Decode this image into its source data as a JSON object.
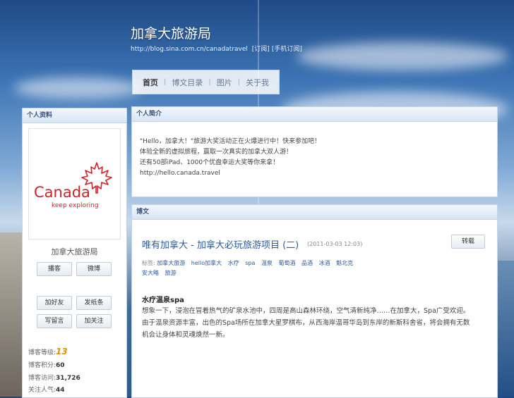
{
  "header": {
    "title": "加拿大旅游局",
    "url": "http://blog.sina.com.cn/canadatravel",
    "subscribe_link": "[订阅]",
    "mobile_subscribe_link": "[手机订阅]"
  },
  "nav": {
    "items": [
      "首页",
      "博文目录",
      "图片",
      "关于我"
    ]
  },
  "profile": {
    "heading": "个人资料",
    "logo_text": "Canada",
    "logo_tagline": "keep exploring",
    "name": "加拿大旅游局",
    "btn_blog": "播客",
    "btn_weibo": "微博",
    "btn_add_friend": "加好友",
    "btn_note": "发纸条",
    "btn_message": "写留言",
    "btn_follow": "加关注",
    "stats": {
      "level_label": "博客等级:",
      "level_value": "13",
      "points_label": "博客积分:",
      "points_value": "60",
      "visits_label": "博客访问:",
      "visits_value": "31,726",
      "followers_label": "关注人气:",
      "followers_value": "44"
    }
  },
  "intro": {
    "heading": "个人简介",
    "lines": [
      "\"Hello，加拿大！\"旅游大奖活动正在火爆进行中！快来参加吧！",
      "体验全新的虚拟旅程，赢取一次真实的加拿大双人游！",
      "还有50部iPad、1000个优盘幸运大奖等你来拿！",
      "http://hello.canada.travel"
    ]
  },
  "posts": {
    "heading": "博文",
    "title": "唯有加拿大 - 加拿大必玩旅游项目 (二)",
    "time": "(2011-03-03 12:03)",
    "share_label": "转载",
    "tags_label": "标签:",
    "tags": [
      "加拿大旅游",
      "hello加拿大",
      "水疗",
      "spa",
      "温泉",
      "葡萄酒",
      "品酒",
      "冰酒",
      "魁北克",
      "安大略",
      "旅游"
    ],
    "section_title": "水疗温泉spa",
    "body_lines": [
      "想象一下，浸泡在冒着热气的矿泉水池中，四周是高山森林环绕，空气清新纯净……在加拿大，Spa广受欢迎。",
      "由于温泉资源丰富，出色的Spa场所在加拿大星罗棋布，从西海岸温哥华岛到东岸的新斯科舍省，将会拥有无数",
      "机会让身体和灵魂焕然一新。"
    ]
  },
  "colors": {
    "link_blue": "#2a5a9e",
    "brand_red": "#d2232a",
    "level_orange": "#e38f00"
  }
}
